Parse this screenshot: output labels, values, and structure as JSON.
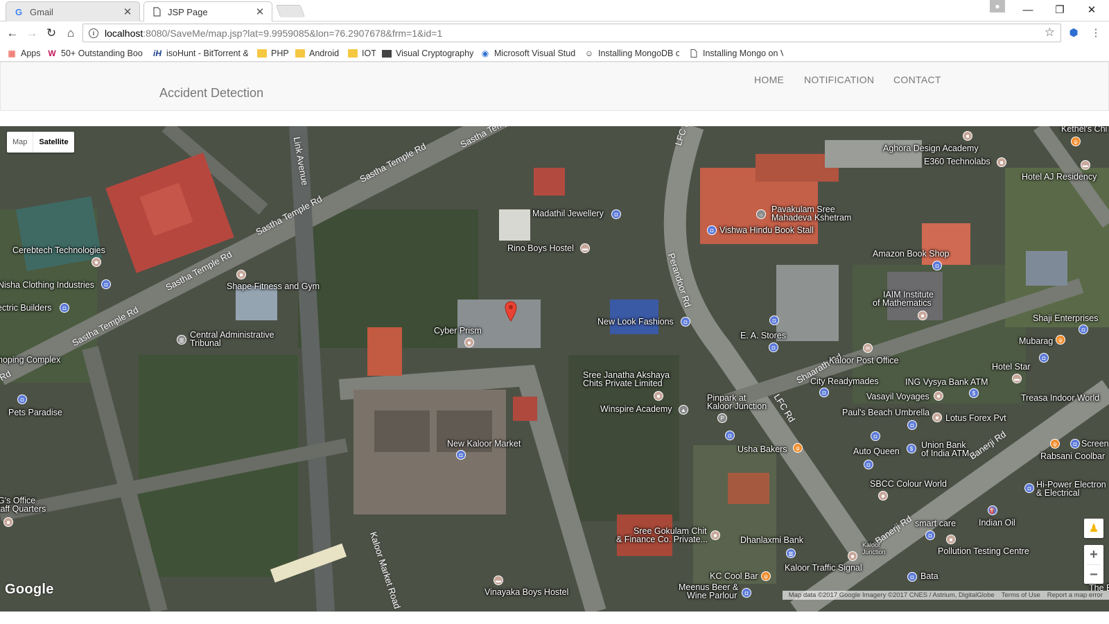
{
  "browser": {
    "tabs": [
      {
        "title": "Gmail",
        "favicon": "G"
      },
      {
        "title": "JSP Page",
        "favicon": "page-icon"
      }
    ],
    "url_host": "localhost",
    "url_rest": ":8080/SaveMe/map.jsp?lat=9.9959085&lon=76.2907678&frm=1&id=1",
    "bookmarks": [
      {
        "label": "Apps",
        "icon": "apps-icon"
      },
      {
        "label": "50+ Outstanding Boo",
        "icon": "W"
      },
      {
        "label": "isoHunt - BitTorrent &",
        "icon": "iH"
      },
      {
        "label": "PHP",
        "icon": "folder-icon"
      },
      {
        "label": "Android",
        "icon": "folder-icon"
      },
      {
        "label": "IOT",
        "icon": "folder-icon"
      },
      {
        "label": "Visual Cryptography",
        "icon": "page-icon"
      },
      {
        "label": "Microsoft Visual Studi",
        "icon": "globe-icon"
      },
      {
        "label": "Installing MongoDB o",
        "icon": "github-icon"
      },
      {
        "label": "Installing Mongo on V",
        "icon": "page-icon"
      }
    ]
  },
  "header": {
    "brand": "Accident Detection",
    "nav": [
      "HOME",
      "NOTIFICATION",
      "CONTACT"
    ]
  },
  "map": {
    "type_buttons": [
      "Map",
      "Satellite"
    ],
    "selected_type": "Satellite",
    "roads": [
      "Sastha Temple Rd",
      "Sastha Temple Rd",
      "Sastha Temple Rd",
      "Sastha Temple Rd",
      "Sastha Temple Rd",
      "Link Avenue",
      "LFC Rd",
      "Perandoor Rd",
      "Shaarath Rd",
      "LFC Rd",
      "Banerji Rd",
      "Banerji Rd",
      "Kaloor Market Road",
      "Rd"
    ],
    "places": [
      "Kethel's Chi",
      "Aghora Design Academy",
      "E360 Technolabs",
      "Hotel AJ Residency",
      "Madathil Jewellery",
      "Pavakulam Sree",
      "Mahadeva Kshetram",
      "Vishwa Hindu Book Stall",
      "Rino Boys Hostel",
      "Cerebtech Technologies",
      "Amazon Book Shop",
      "Nisha Clothing Industries",
      "Shape Fitness and Gym",
      "ectric Builders",
      "IAIM Institute",
      "of Mathematics",
      "New Look Fashions",
      "Shaji Enterprises",
      "Cyber Prism",
      "Central Administrative",
      "Tribunal",
      "E. A. Stores",
      "Mubarag",
      "hoping Complex",
      "Kaloor Post Office",
      "Hotel Star",
      "Sree Janatha Akshaya",
      "Chits Private Limited",
      "City Readymades",
      "ING Vysya Bank ATM",
      "Treasa Indoor World",
      "Pets Paradise",
      "Pinpark at",
      "Kaloor Junction",
      "Vasayil Voyages",
      "Winspire Academy",
      "Paul's Beach Umbrella",
      "Lotus Forex Pvt",
      "New Kaloor Market",
      "Union Bank",
      "of India ATM",
      "Screen",
      "Usha Bakers",
      "Auto Queen",
      "Rabsani Coolbar",
      "SBCC Colour World",
      "Hi-Power Electron",
      "& Electrical",
      "G's Office",
      "taff Quarters",
      "smart care",
      "Indian Oil",
      "Sree Gokulam Chit",
      "& Finance Co. Private...",
      "Dhanlaxmi Bank",
      "Pollution Testing Centre",
      "Kaloor",
      "Junction",
      "Kaloor Traffic Signal",
      "KC Cool Bar",
      "Bata",
      "Meenus Beer &",
      "Wine Parlour",
      "Vinayaka Boys Hostel",
      "The E"
    ],
    "logo": "Google",
    "attribution": [
      "Map data ©2017 Google Imagery ©2017 CNES / Astrium, DigitalGlobe",
      "Terms of Use",
      "Report a map error"
    ],
    "zoom_in": "+",
    "zoom_out": "−"
  }
}
